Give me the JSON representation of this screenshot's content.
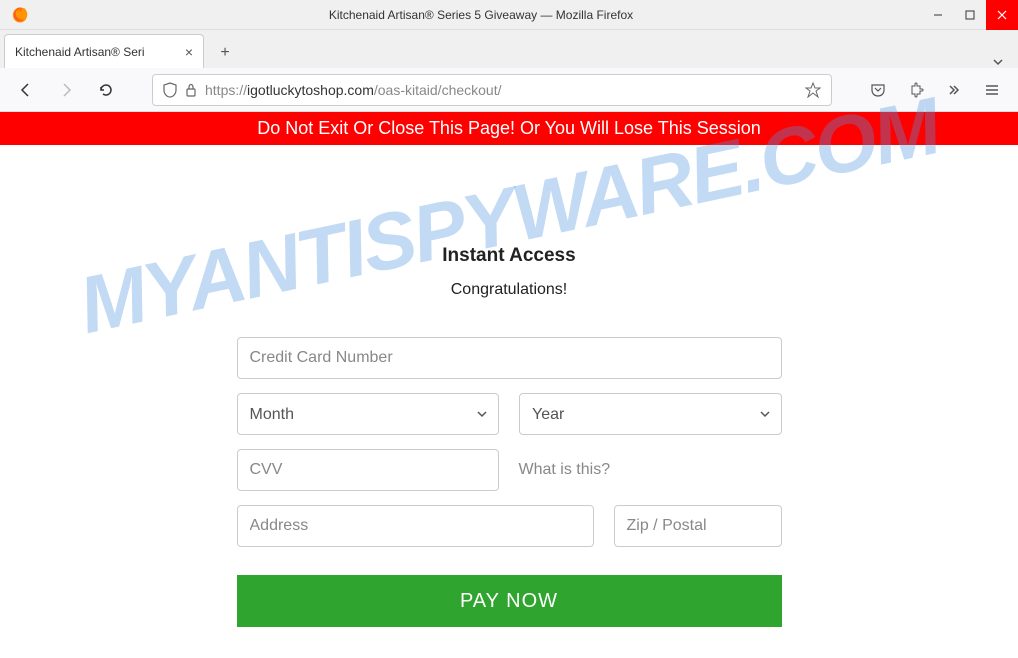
{
  "window": {
    "title": "Kitchenaid Artisan® Series 5 Giveaway — Mozilla Firefox"
  },
  "tab": {
    "title": "Kitchenaid Artisan® Seri"
  },
  "url": {
    "prefix": "https://",
    "domain": "igotluckytoshop.com",
    "path": "/oas-kitaid/checkout/"
  },
  "banner": {
    "text": "Do Not Exit Or Close This Page! Or You Will Lose This Session"
  },
  "page": {
    "heading": "Instant Access",
    "subheading": "Congratulations!"
  },
  "form": {
    "card_placeholder": "Credit Card Number",
    "month_label": "Month",
    "year_label": "Year",
    "cvv_placeholder": "CVV",
    "what_is_this": "What is this?",
    "address_placeholder": "Address",
    "zip_placeholder": "Zip / Postal",
    "pay_label": "PAY NOW"
  },
  "watermark": {
    "text": "MYANTISPYWARE.COM"
  }
}
